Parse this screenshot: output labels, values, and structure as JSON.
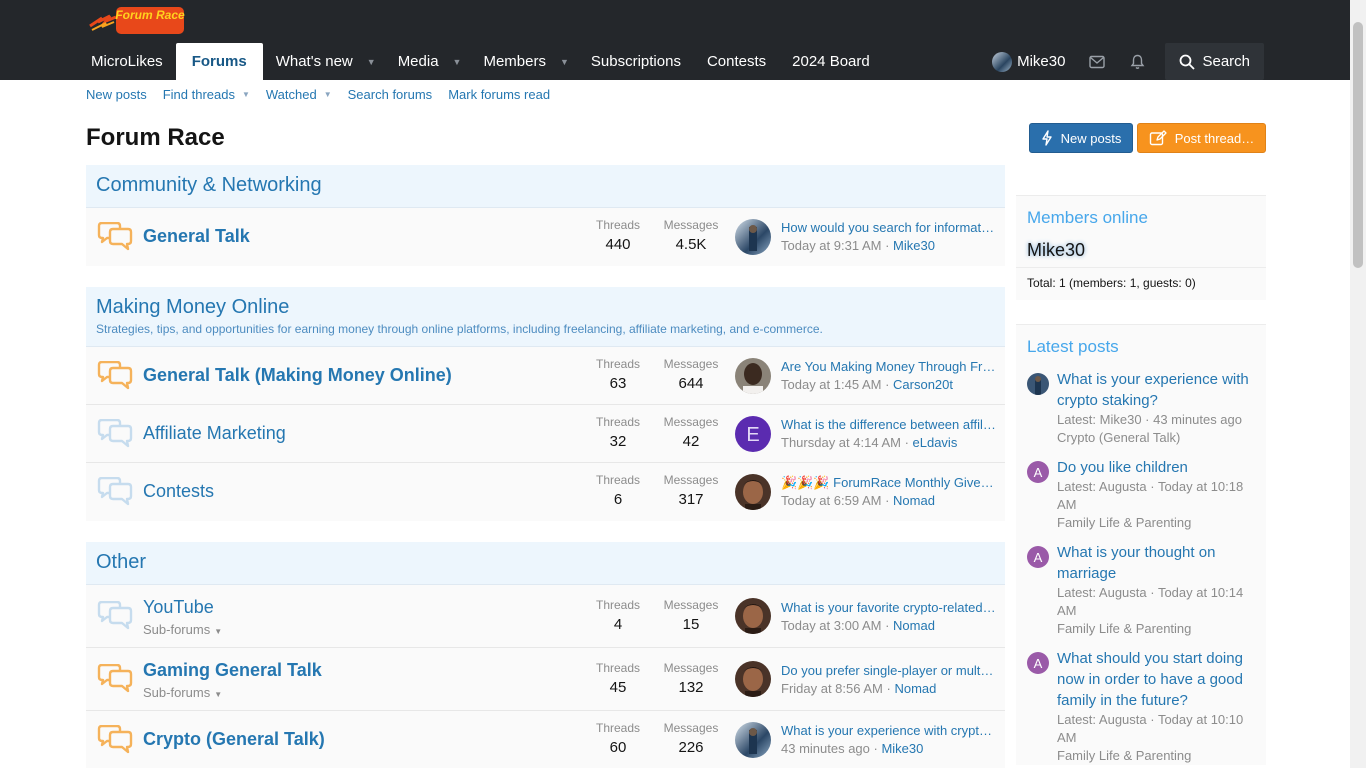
{
  "header": {
    "logo_text": "Forum Race",
    "nav": [
      {
        "label": "MicroLikes",
        "active": false,
        "caret": false
      },
      {
        "label": "Forums",
        "active": true,
        "caret": false
      },
      {
        "label": "What's new",
        "active": false,
        "caret": true
      },
      {
        "label": "Media",
        "active": false,
        "caret": true
      },
      {
        "label": "Members",
        "active": false,
        "caret": true
      },
      {
        "label": "Subscriptions",
        "active": false,
        "caret": false
      },
      {
        "label": "Contests",
        "active": false,
        "caret": false
      },
      {
        "label": "2024 Board",
        "active": false,
        "caret": false
      }
    ],
    "user_name": "Mike30",
    "search_label": "Search"
  },
  "subnav": {
    "new_posts": "New posts",
    "find_threads": "Find threads",
    "watched": "Watched",
    "search_forums": "Search forums",
    "mark_read": "Mark forums read"
  },
  "page": {
    "title": "Forum Race",
    "new_posts_btn": "New posts",
    "post_thread_btn": "Post thread…"
  },
  "categories": [
    {
      "title": "Community & Networking",
      "description": "",
      "forums": [
        {
          "title": "General Talk",
          "unread": true,
          "subforums": "",
          "threads_label": "Threads",
          "threads": "440",
          "messages_label": "Messages",
          "messages": "4.5K",
          "last_title": "How would you search for information about a company?",
          "last_time": "Today at 9:31 AM",
          "last_user": "Mike30",
          "avatar": "mike"
        }
      ]
    },
    {
      "title": "Making Money Online",
      "description": "Strategies, tips, and opportunities for earning money through online platforms, including freelancing, affiliate marketing, and e-commerce.",
      "forums": [
        {
          "title": "General Talk (Making Money Online)",
          "unread": true,
          "subforums": "",
          "threads_label": "Threads",
          "threads": "63",
          "messages_label": "Messages",
          "messages": "644",
          "last_title": "Are You Making Money Through Freelancing?",
          "last_time": "Today at 1:45 AM",
          "last_user": "Carson20t",
          "avatar": "carson"
        },
        {
          "title": "Affiliate Marketing",
          "unread": false,
          "subforums": "",
          "threads_label": "Threads",
          "threads": "32",
          "messages_label": "Messages",
          "messages": "42",
          "last_title": "What is the difference between affiliate marketing and dropshipping?",
          "last_time": "Thursday at 4:14 AM",
          "last_user": "eLdavis",
          "avatar": "eldavis"
        },
        {
          "title": "Contests",
          "unread": false,
          "subforums": "",
          "threads_label": "Threads",
          "threads": "6",
          "messages_label": "Messages",
          "messages": "317",
          "last_title": "🎉🎉🎉 ForumRace Monthly Giveaway",
          "last_time": "Today at 6:59 AM",
          "last_user": "Nomad",
          "avatar": "nomad"
        }
      ]
    },
    {
      "title": "Other",
      "description": "",
      "forums": [
        {
          "title": "YouTube",
          "unread": false,
          "subforums": "Sub-forums",
          "threads_label": "Threads",
          "threads": "4",
          "messages_label": "Messages",
          "messages": "15",
          "last_title": "What is your favorite crypto-related YouTube channel?",
          "last_time": "Today at 3:00 AM",
          "last_user": "Nomad",
          "avatar": "nomad"
        },
        {
          "title": "Gaming General Talk",
          "unread": true,
          "subforums": "Sub-forums",
          "threads_label": "Threads",
          "threads": "45",
          "messages_label": "Messages",
          "messages": "132",
          "last_title": "Do you prefer single-player or multiplayer games?",
          "last_time": "Friday at 8:56 AM",
          "last_user": "Nomad",
          "avatar": "nomad"
        },
        {
          "title": "Crypto (General Talk)",
          "unread": true,
          "subforums": "",
          "threads_label": "Threads",
          "threads": "60",
          "messages_label": "Messages",
          "messages": "226",
          "last_title": "What is your experience with crypto staking?",
          "last_time": "43 minutes ago",
          "last_user": "Mike30",
          "avatar": "mike"
        }
      ]
    }
  ],
  "sidebar": {
    "members_online_title": "Members online",
    "online_user": "Mike30",
    "total": "Total: 1 (members: 1, guests: 0)",
    "latest_title": "Latest posts",
    "latest": [
      {
        "title": "What is your experience with crypto staking?",
        "latest": "Latest: Mike30 · 43 minutes ago",
        "forum": "Crypto (General Talk)",
        "avatar": "mike",
        "letter": ""
      },
      {
        "title": "Do you like children",
        "latest": "Latest: Augusta · Today at 10:18 AM",
        "forum": "Family Life & Parenting",
        "avatar": "letter",
        "letter": "A"
      },
      {
        "title": "What is your thought on marriage",
        "latest": "Latest: Augusta · Today at 10:14 AM",
        "forum": "Family Life & Parenting",
        "avatar": "letter",
        "letter": "A"
      },
      {
        "title": "What should you start doing now in order to have a good family in the future?",
        "latest": "Latest: Augusta · Today at 10:10 AM",
        "forum": "Family Life & Parenting",
        "avatar": "letter",
        "letter": "A"
      }
    ]
  },
  "colors": {
    "accent": "#2577b1",
    "header_bg": "#24272b",
    "cta_orange": "#f7931e",
    "cta_blue": "#2a6fac"
  }
}
